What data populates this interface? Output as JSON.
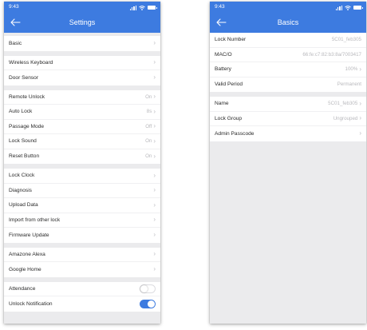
{
  "left": {
    "time": "9:43",
    "title": "Settings",
    "groups": [
      {
        "items": [
          {
            "label": "Basic",
            "value": ""
          }
        ]
      },
      {
        "items": [
          {
            "label": "Wireless Keyboard",
            "value": ""
          },
          {
            "label": "Door Sensor",
            "value": ""
          }
        ]
      },
      {
        "items": [
          {
            "label": "Remote Unlock",
            "value": "On"
          },
          {
            "label": "Auto Lock",
            "value": "8s"
          },
          {
            "label": "Passage Mode",
            "value": "Off"
          },
          {
            "label": "Lock Sound",
            "value": "On"
          },
          {
            "label": "Reset Button",
            "value": "On"
          }
        ]
      },
      {
        "items": [
          {
            "label": "Lock Clock",
            "value": ""
          },
          {
            "label": "Diagnosis",
            "value": ""
          },
          {
            "label": "Upload Data",
            "value": ""
          },
          {
            "label": "Import from other lock",
            "value": ""
          },
          {
            "label": "Firmware Update",
            "value": ""
          }
        ]
      },
      {
        "items": [
          {
            "label": "Amazone Alexa",
            "value": ""
          },
          {
            "label": "Google Home",
            "value": ""
          }
        ]
      },
      {
        "items": [
          {
            "label": "Attendance",
            "toggle": false
          },
          {
            "label": "Unlock Notification",
            "toggle": true
          }
        ]
      }
    ]
  },
  "right": {
    "time": "9:43",
    "title": "Basics",
    "groups": [
      {
        "items": [
          {
            "label": "Lock Number",
            "value": "5C01_feb305"
          },
          {
            "label": "MAC/O",
            "value": "66:fe:c7:82:b3:8a/7003417"
          },
          {
            "label": "Battery",
            "value": "100%"
          },
          {
            "label": "Valid Period",
            "value": "Permanent"
          }
        ]
      },
      {
        "items": [
          {
            "label": "Name",
            "value": "5C01_feb305"
          },
          {
            "label": "Lock Group",
            "value": "Ungrouped"
          },
          {
            "label": "Admin Passcode",
            "value": ""
          }
        ]
      }
    ]
  },
  "colors": {
    "accent": "#3d7be0",
    "background": "#ebebed",
    "value_text": "#b9b9bd"
  },
  "icons": {
    "back": "arrow-left-icon",
    "chevron": "chevron-right-icon"
  }
}
